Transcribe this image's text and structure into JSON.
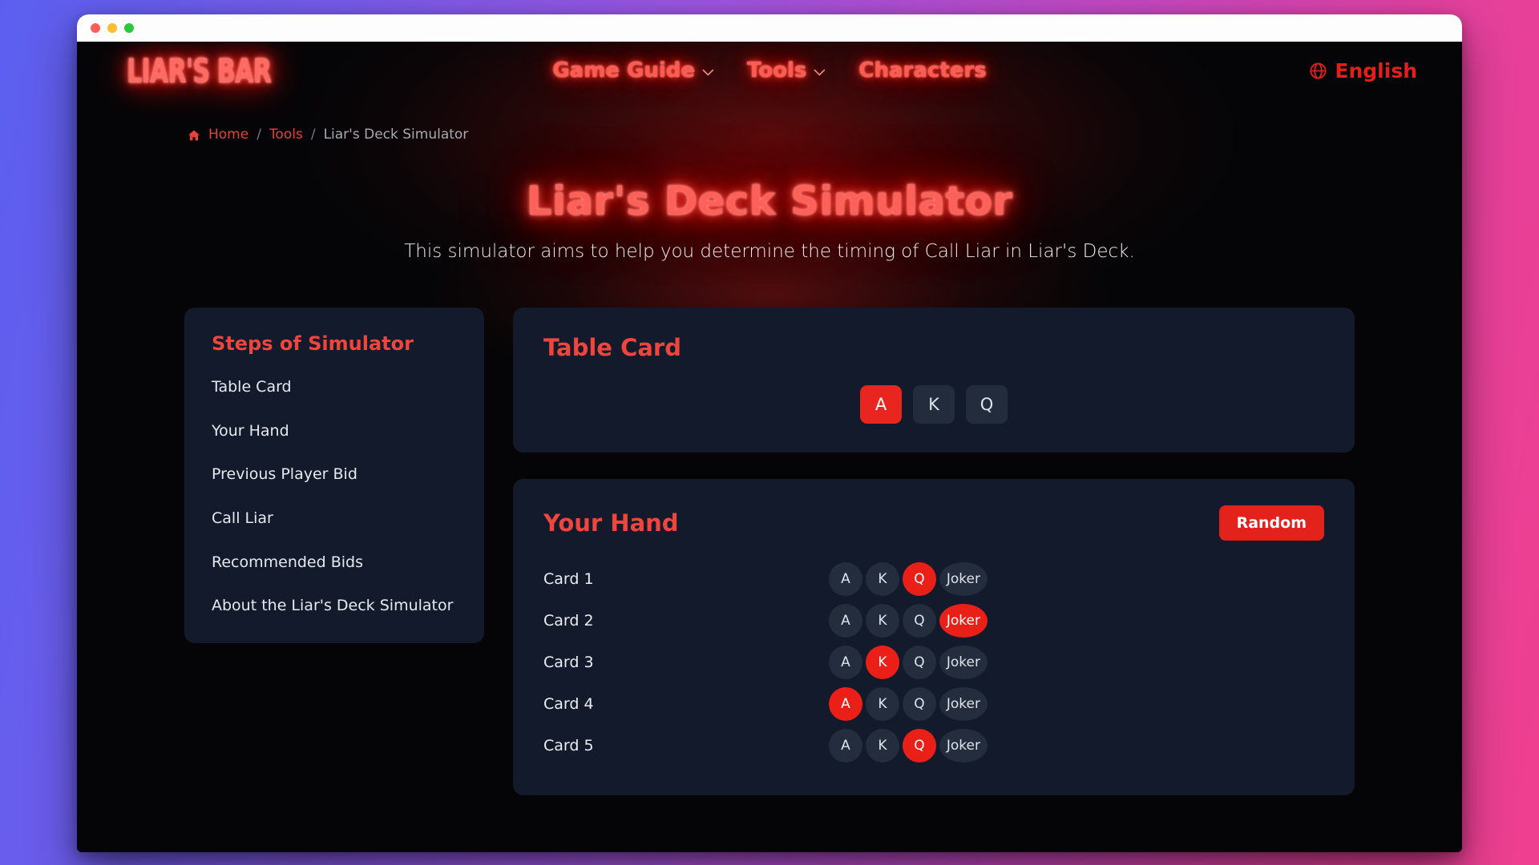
{
  "window": {
    "traffic_lights": [
      "close-red",
      "minimize-yellow",
      "maximize-green"
    ]
  },
  "header": {
    "logo": "LIAR'S BAR",
    "nav": [
      {
        "label": "Game Guide",
        "has_dropdown": true
      },
      {
        "label": "Tools",
        "has_dropdown": true
      },
      {
        "label": "Characters",
        "has_dropdown": false
      }
    ],
    "language": {
      "icon": "globe-icon",
      "label": "English"
    }
  },
  "breadcrumb": {
    "home_icon": "home-icon",
    "items": [
      {
        "label": "Home",
        "current": false
      },
      {
        "label": "Tools",
        "current": false
      },
      {
        "label": "Liar's Deck Simulator",
        "current": true
      }
    ],
    "separator": "/"
  },
  "hero": {
    "title": "Liar's Deck Simulator",
    "subtitle": "This simulator aims to help you determine the timing of Call Liar in Liar's Deck."
  },
  "sidebar": {
    "title": "Steps of Simulator",
    "items": [
      {
        "label": "Table Card"
      },
      {
        "label": "Your Hand"
      },
      {
        "label": "Previous Player Bid"
      },
      {
        "label": "Call Liar"
      },
      {
        "label": "Recommended Bids"
      },
      {
        "label": "About the Liar's Deck Simulator"
      }
    ]
  },
  "table_card": {
    "title": "Table Card",
    "options": [
      {
        "label": "A",
        "selected": true
      },
      {
        "label": "K",
        "selected": false
      },
      {
        "label": "Q",
        "selected": false
      }
    ]
  },
  "your_hand": {
    "title": "Your Hand",
    "random_button": "Random",
    "rows": [
      {
        "label": "Card 1",
        "options": [
          {
            "label": "A",
            "selected": false
          },
          {
            "label": "K",
            "selected": false
          },
          {
            "label": "Q",
            "selected": true
          },
          {
            "label": "Joker",
            "selected": false
          }
        ]
      },
      {
        "label": "Card 2",
        "options": [
          {
            "label": "A",
            "selected": false
          },
          {
            "label": "K",
            "selected": false
          },
          {
            "label": "Q",
            "selected": false
          },
          {
            "label": "Joker",
            "selected": true
          }
        ]
      },
      {
        "label": "Card 3",
        "options": [
          {
            "label": "A",
            "selected": false
          },
          {
            "label": "K",
            "selected": true
          },
          {
            "label": "Q",
            "selected": false
          },
          {
            "label": "Joker",
            "selected": false
          }
        ]
      },
      {
        "label": "Card 4",
        "options": [
          {
            "label": "A",
            "selected": true
          },
          {
            "label": "K",
            "selected": false
          },
          {
            "label": "Q",
            "selected": false
          },
          {
            "label": "Joker",
            "selected": false
          }
        ]
      },
      {
        "label": "Card 5",
        "options": [
          {
            "label": "A",
            "selected": false
          },
          {
            "label": "K",
            "selected": false
          },
          {
            "label": "Q",
            "selected": true
          },
          {
            "label": "Joker",
            "selected": false
          }
        ]
      }
    ]
  },
  "colors": {
    "accent_red": "#e8251e",
    "neon_red": "#ff5a50",
    "panel_bg": "#131a2b",
    "card_bg": "#232d3e",
    "page_bg": "#050507",
    "gradient_start": "#5b5fef",
    "gradient_end": "#ef3f8f"
  }
}
